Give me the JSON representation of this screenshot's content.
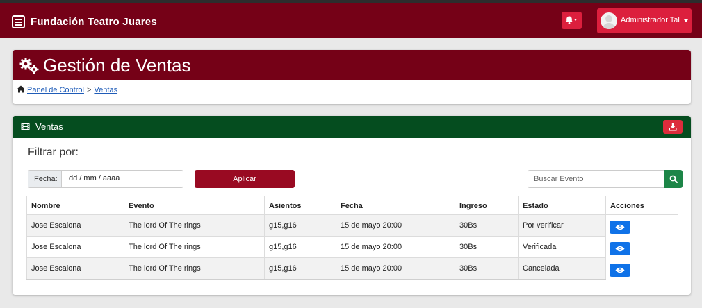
{
  "navbar": {
    "brand": "Fundación Teatro Juares",
    "user_name": "Administrador Tal"
  },
  "header": {
    "title": "Gestión de Ventas",
    "breadcrumb": [
      "Panel de Control",
      "Ventas"
    ],
    "separator": ">"
  },
  "sales_card": {
    "title": "Ventas",
    "filter_label": "Filtrar por:",
    "date_label": "Fecha:",
    "date_placeholder": "dd / mm / aaaa",
    "apply_label": "Aplicar",
    "search_placeholder": "Buscar Evento",
    "columns": [
      "Nombre",
      "Evento",
      "Asientos",
      "Fecha",
      "Ingreso",
      "Estado",
      "Acciones"
    ],
    "rows": [
      {
        "nombre": "Jose Escalona",
        "evento": "The lord Of The rings",
        "asientos": "g15,g16",
        "fecha": "15 de mayo 20:00",
        "ingreso": "30Bs",
        "estado": "Por verificar"
      },
      {
        "nombre": "Jose Escalona",
        "evento": "The lord Of The rings",
        "asientos": "g15,g16",
        "fecha": "15 de mayo 20:00",
        "ingreso": "30Bs",
        "estado": "Verificada"
      },
      {
        "nombre": "Jose Escalona",
        "evento": "The lord Of The rings",
        "asientos": "g15,g16",
        "fecha": "15 de mayo 20:00",
        "ingreso": "30Bs",
        "estado": "Cancelada"
      }
    ]
  },
  "colors": {
    "navbar": "#750117",
    "header_band": "#750117",
    "sales_header": "#054d1f",
    "accent_red": "#dc1f3d",
    "apply_button": "#990a22",
    "search_button": "#1c8547",
    "view_button": "#0f72e8"
  },
  "icons": [
    "menu-icon",
    "bell-icon",
    "avatar",
    "cogs-icon",
    "home-icon",
    "film-icon",
    "download-icon",
    "search-icon",
    "eye-icon"
  ]
}
